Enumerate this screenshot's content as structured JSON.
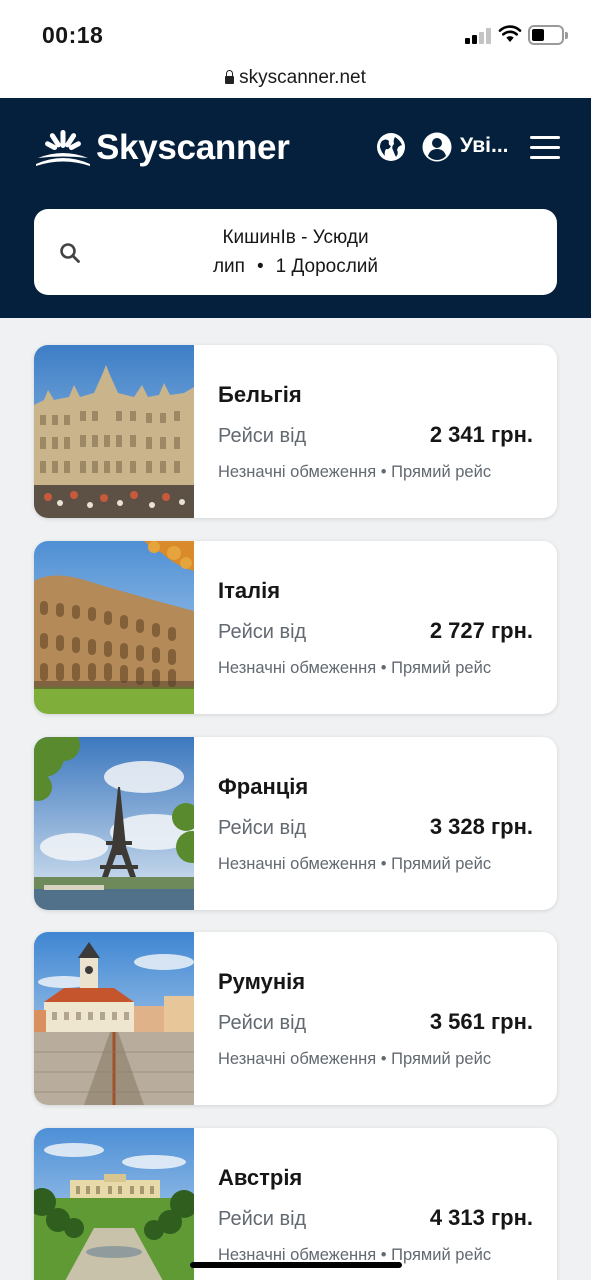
{
  "status_bar": {
    "time": "00:18"
  },
  "browser": {
    "url": "skyscanner.net"
  },
  "header": {
    "logo_text": "Skyscanner",
    "login_label": "Уві...",
    "colors": {
      "header_bg": "#05203c"
    },
    "icons": [
      "globe-icon",
      "user-icon",
      "hamburger-menu-icon"
    ]
  },
  "search": {
    "route": "КишинІв - Усюди",
    "period": "лип",
    "dot": "•",
    "passengers": "1 Дорослий"
  },
  "destinations": [
    {
      "name": "Бельгія",
      "from_label": "Рейси від",
      "price": "2 341 грн.",
      "restrictions": "Незначні обмеження",
      "flight_type": "Прямий рейс"
    },
    {
      "name": "Італія",
      "from_label": "Рейси від",
      "price": "2 727 грн.",
      "restrictions": "Незначні обмеження",
      "flight_type": "Прямий рейс"
    },
    {
      "name": "Франція",
      "from_label": "Рейси від",
      "price": "3 328 грн.",
      "restrictions": "Незначні обмеження",
      "flight_type": "Прямий рейс"
    },
    {
      "name": "Румунія",
      "from_label": "Рейси від",
      "price": "3 561 грн.",
      "restrictions": "Незначні обмеження",
      "flight_type": "Прямий рейс"
    },
    {
      "name": "Австрія",
      "from_label": "Рейси від",
      "price": "4 313 грн.",
      "restrictions": "Незначні обмеження",
      "flight_type": "Прямий рейс"
    }
  ],
  "meta_separator": " • "
}
